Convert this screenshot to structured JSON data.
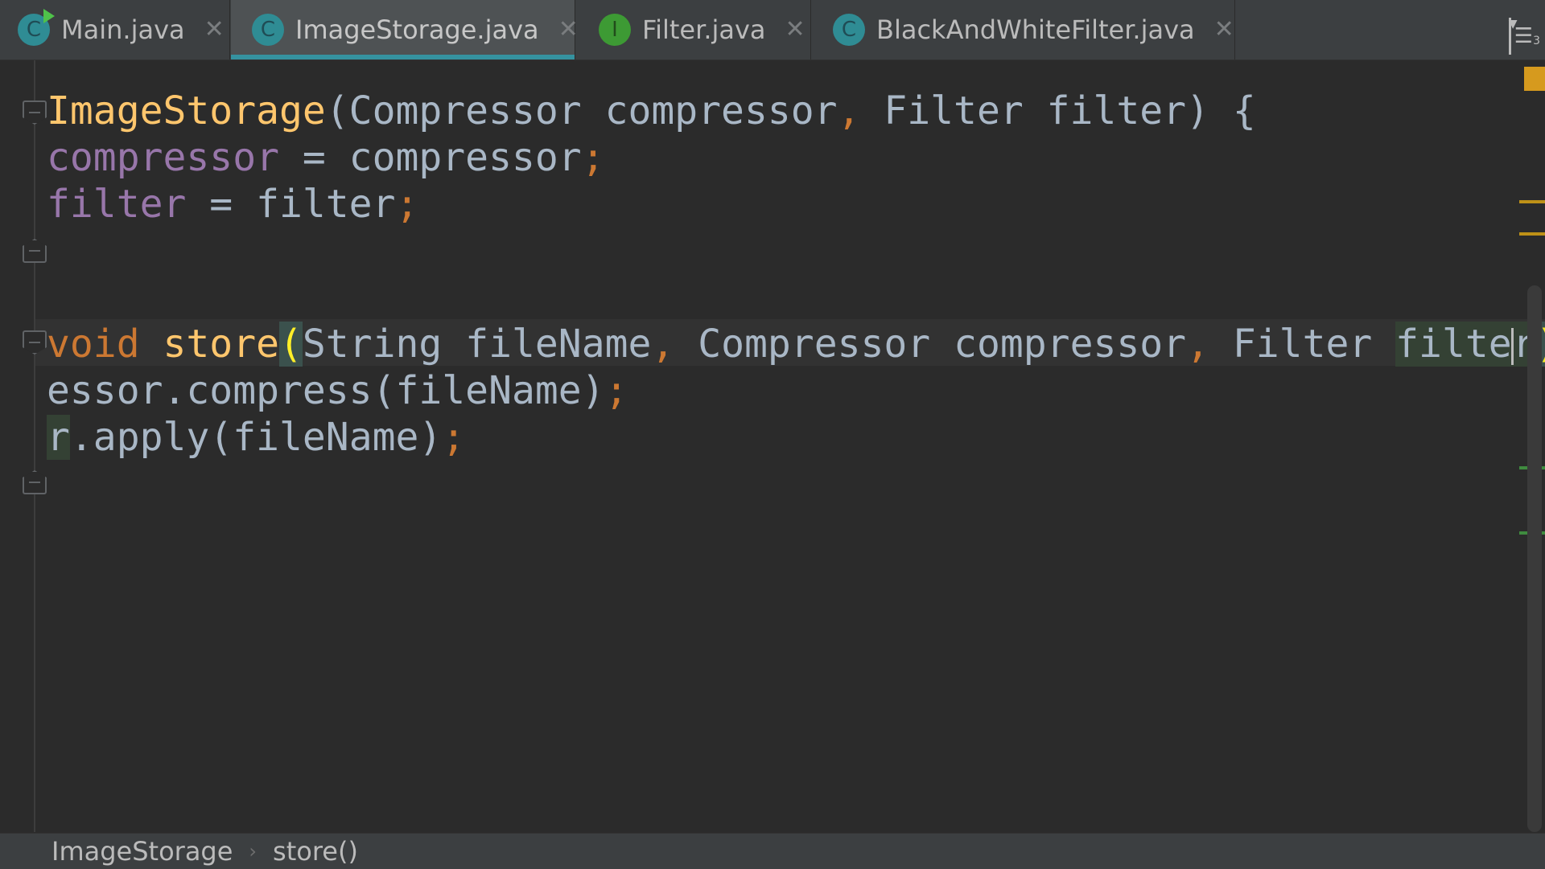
{
  "tabs": [
    {
      "label": "Main.java",
      "icon": "class-icon",
      "icon_letter": "C",
      "running": true,
      "active": false
    },
    {
      "label": "ImageStorage.java",
      "icon": "class-icon",
      "icon_letter": "C",
      "active": true
    },
    {
      "label": "Filter.java",
      "icon": "interface-icon",
      "icon_letter": "I",
      "active": false
    },
    {
      "label": "BlackAndWhiteFilter.java",
      "icon": "class-icon",
      "icon_letter": "C",
      "active": false
    }
  ],
  "tab_menu": {
    "icon": "tab-list-icon",
    "count": "3"
  },
  "code_lines": {
    "l1": {
      "fn": "ImageStorage",
      "a": "(Compressor compressor",
      "p1": ",",
      "b": " Filter filter) {"
    },
    "l2": {
      "field": "compressor",
      "a": " = compressor",
      "p": ";"
    },
    "l3": {
      "field": "filter",
      "a": " = filter",
      "p": ";"
    },
    "l4": {
      "kw": "void ",
      "fn": "store",
      "open": "(",
      "a": "String fileName",
      "p1": ",",
      "b": " Compressor compressor",
      "p2": ",",
      "c": " Filter ",
      "param": "filte",
      "param_end": "r",
      "close": ")",
      "d": " {"
    },
    "l5": {
      "a": "essor.compress(fileName)",
      "p": ";"
    },
    "l6": {
      "param": "r",
      "a": ".apply(fileName)",
      "p": ";"
    }
  },
  "breadcrumb": {
    "class": "ImageStorage",
    "separator": "›",
    "method": "store()"
  },
  "colors": {
    "background": "#2b2b2b",
    "keyword": "#cc7832",
    "function": "#ffc66d",
    "field": "#9876aa",
    "text": "#a9b7c6",
    "active_tab_underline": "#3592a0"
  }
}
